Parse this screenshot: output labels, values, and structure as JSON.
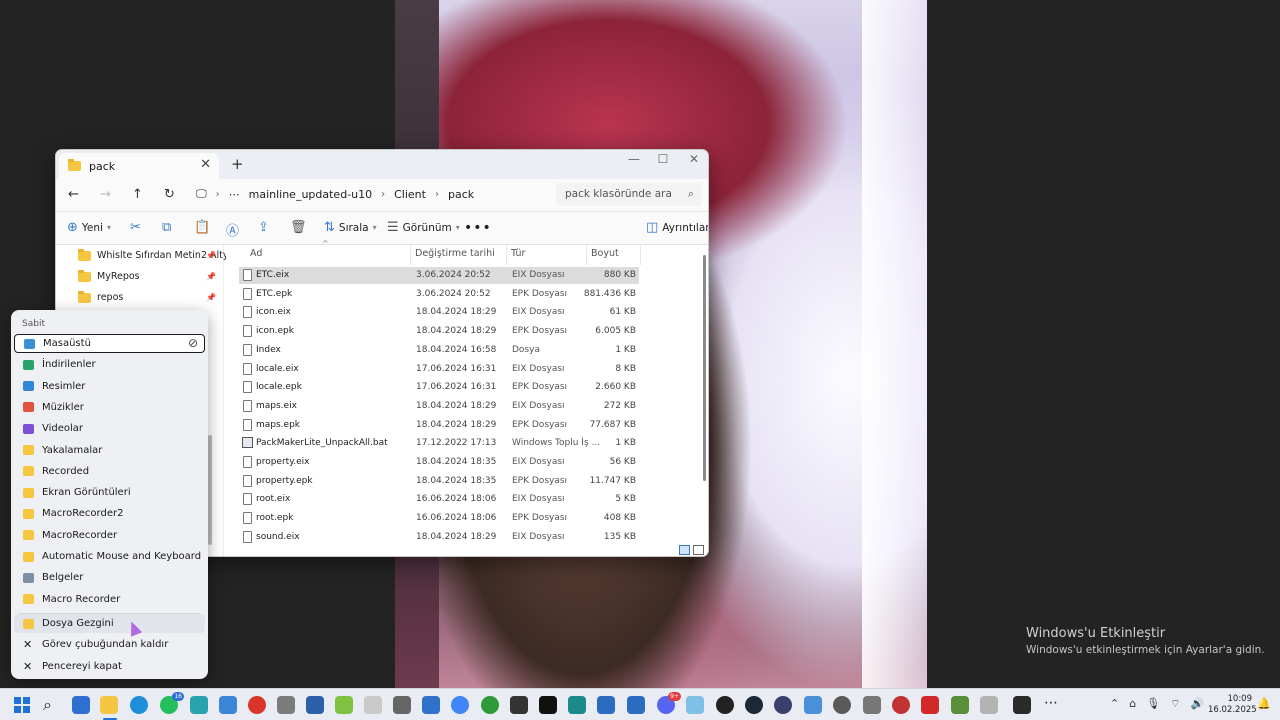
{
  "explorer": {
    "tab_title": "pack",
    "breadcrumb": [
      "mainline_updated-u10",
      "Client",
      "pack"
    ],
    "search_placeholder": "pack klasöründe ara",
    "toolbar": {
      "new_label": "Yeni",
      "sort_label": "Sırala",
      "view_label": "Görünüm",
      "details_label": "Ayrıntılar"
    },
    "columns": {
      "name": "Ad",
      "date": "Değiştirme tarihi",
      "type": "Tür",
      "size": "Boyut"
    },
    "nav_items": [
      {
        "label": "Whislte Sıfırdan Metin2 Altyapı"
      },
      {
        "label": "MyRepos"
      },
      {
        "label": "repos"
      }
    ],
    "files": [
      {
        "name": "ETC.eix",
        "date": "3.06.2024 20:52",
        "type": "EIX Dosyası",
        "size": "880 KB",
        "selected": true
      },
      {
        "name": "ETC.epk",
        "date": "3.06.2024 20:52",
        "type": "EPK Dosyası",
        "size": "881.436 KB"
      },
      {
        "name": "icon.eix",
        "date": "18.04.2024 18:29",
        "type": "EIX Dosyası",
        "size": "61 KB"
      },
      {
        "name": "icon.epk",
        "date": "18.04.2024 18:29",
        "type": "EPK Dosyası",
        "size": "6.005 KB"
      },
      {
        "name": "Index",
        "date": "18.04.2024 16:58",
        "type": "Dosya",
        "size": "1 KB"
      },
      {
        "name": "locale.eix",
        "date": "17.06.2024 16:31",
        "type": "EIX Dosyası",
        "size": "8 KB"
      },
      {
        "name": "locale.epk",
        "date": "17.06.2024 16:31",
        "type": "EPK Dosyası",
        "size": "2.660 KB"
      },
      {
        "name": "maps.eix",
        "date": "18.04.2024 18:29",
        "type": "EIX Dosyası",
        "size": "272 KB"
      },
      {
        "name": "maps.epk",
        "date": "18.04.2024 18:29",
        "type": "EPK Dosyası",
        "size": "77.687 KB"
      },
      {
        "name": "PackMakerLite_UnpackAll.bat",
        "date": "17.12.2022 17:13",
        "type": "Windows Toplu İş ...",
        "size": "1 KB",
        "bat": true
      },
      {
        "name": "property.eix",
        "date": "18.04.2024 18:35",
        "type": "EIX Dosyası",
        "size": "56 KB"
      },
      {
        "name": "property.epk",
        "date": "18.04.2024 18:35",
        "type": "EPK Dosyası",
        "size": "11.747 KB"
      },
      {
        "name": "root.eix",
        "date": "16.06.2024 18:06",
        "type": "EIX Dosyası",
        "size": "5 KB"
      },
      {
        "name": "root.epk",
        "date": "16.06.2024 18:06",
        "type": "EPK Dosyası",
        "size": "408 KB"
      },
      {
        "name": "sound.eix",
        "date": "18.04.2024 18:29",
        "type": "EIX Dosyası",
        "size": "135 KB"
      }
    ]
  },
  "jumplist": {
    "header": "Sabit",
    "pinned": [
      {
        "label": "Masaüstü",
        "color": "#3a8fd9"
      },
      {
        "label": "İndirilenler",
        "color": "#27a36b"
      },
      {
        "label": "Resimler",
        "color": "#2f86d6"
      },
      {
        "label": "Müzikler",
        "color": "#e0533d"
      },
      {
        "label": "Videolar",
        "color": "#7b4fd6"
      },
      {
        "label": "Yakalamalar",
        "color": "#f4c641"
      },
      {
        "label": "Recorded",
        "color": "#f4c641"
      },
      {
        "label": "Ekran Görüntüleri",
        "color": "#f4c641"
      },
      {
        "label": "MacroRecorder2",
        "color": "#f4c641"
      },
      {
        "label": "MacroRecorder",
        "color": "#f4c641"
      },
      {
        "label": "Automatic Mouse and Keyboard",
        "color": "#f4c641"
      },
      {
        "label": "Belgeler",
        "color": "#7d8fa6"
      },
      {
        "label": "Macro Recorder",
        "color": "#f4c641"
      }
    ],
    "actions": [
      {
        "label": "Dosya Gezgini"
      },
      {
        "label": "Görev çubuğundan kaldır"
      },
      {
        "label": "Pencereyi kapat"
      }
    ]
  },
  "activation": {
    "title": "Windows'u Etkinleştir",
    "subtitle": "Windows'u etkinleştirmek için Ayarlar'a gidin."
  },
  "taskbar": {
    "edge_badge": "16",
    "discord_badge": "9+",
    "time": "10:09",
    "date": "16.02.2025"
  }
}
